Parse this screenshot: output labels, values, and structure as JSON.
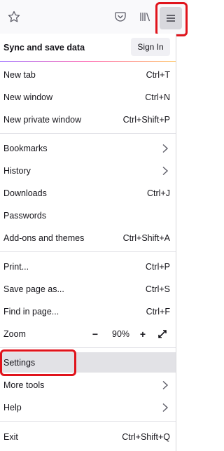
{
  "toolbar": {
    "icons": [
      "star-icon",
      "pocket-icon",
      "library-icon",
      "hamburger-menu-icon"
    ]
  },
  "sync": {
    "label": "Sync and save data",
    "sign_in": "Sign In"
  },
  "menu": {
    "new_tab": {
      "label": "New tab",
      "shortcut": "Ctrl+T"
    },
    "new_window": {
      "label": "New window",
      "shortcut": "Ctrl+N"
    },
    "new_private_window": {
      "label": "New private window",
      "shortcut": "Ctrl+Shift+P"
    },
    "bookmarks": {
      "label": "Bookmarks"
    },
    "history": {
      "label": "History"
    },
    "downloads": {
      "label": "Downloads",
      "shortcut": "Ctrl+J"
    },
    "passwords": {
      "label": "Passwords"
    },
    "addons": {
      "label": "Add-ons and themes",
      "shortcut": "Ctrl+Shift+A"
    },
    "print": {
      "label": "Print...",
      "shortcut": "Ctrl+P"
    },
    "save_page": {
      "label": "Save page as...",
      "shortcut": "Ctrl+S"
    },
    "find": {
      "label": "Find in page...",
      "shortcut": "Ctrl+F"
    },
    "zoom": {
      "label": "Zoom",
      "minus": "−",
      "value": "90%",
      "plus": "+"
    },
    "settings": {
      "label": "Settings"
    },
    "more_tools": {
      "label": "More tools"
    },
    "help": {
      "label": "Help"
    },
    "exit": {
      "label": "Exit",
      "shortcut": "Ctrl+Shift+Q"
    }
  },
  "colors": {
    "highlight_box": "#e0141c",
    "hover_bg": "#e2e2e6"
  }
}
